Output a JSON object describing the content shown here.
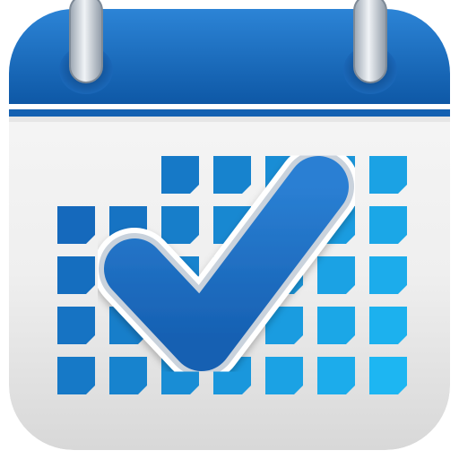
{
  "icon": {
    "name": "calendar-checkmark-app-icon"
  },
  "colors": {
    "header_top": "#2f86d8",
    "header_bottom": "#0f5aa8",
    "body_light": "#f7f7f7",
    "body_shadow": "#d9d9d9",
    "grid_dark": "#1464b8",
    "grid_light": "#1db6f2",
    "check_fill": "#1f6ec5",
    "check_outline": "#ffffff",
    "ring": "#b9c2cc"
  }
}
